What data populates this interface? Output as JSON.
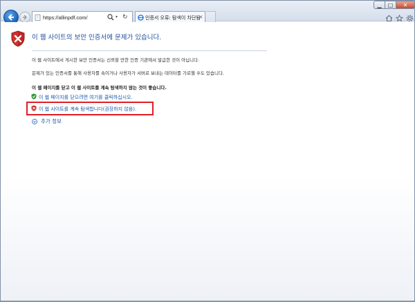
{
  "browser": {
    "url": "https://allinpdf.com/",
    "tab_title": "인증서 오류: 탐색이 차단됨",
    "tab_close": "×",
    "address_dropdown": "▾",
    "refresh_symbol": "↻",
    "window_min": "▁",
    "window_max": "□",
    "window_close": "✕"
  },
  "page": {
    "title": "이 웹 사이트의 보안 인증서에 문제가 있습니다.",
    "paragraph1": "이 웹 사이트에서 게시한 보안 인증서는 신뢰할 만한 인증 기관에서 발급한 것이 아닙니다.",
    "paragraph2": "문제가 있는 인증서를 통해 사용자를 속이거나 사용자가 서버로 보내는 데이터를 가로챌 수도 있습니다.",
    "paragraph3": "이 웹 페이지를 닫고 이 웹 사이트를 계속 탐색하지 않는 것이 좋습니다.",
    "option_close": "이 웹 페이지를 닫으려면 여기를 클릭하십시오.",
    "option_continue": "이 웹 사이트를 계속 탐색합니다(권장하지 않음).",
    "more_info": "추가 정보"
  },
  "colors": {
    "title_blue": "#1a4e9a",
    "link_blue": "#1a5aa8",
    "highlight_red": "#e01c24",
    "shield_red": "#d0312d",
    "shield_green": "#2e9a3a"
  }
}
